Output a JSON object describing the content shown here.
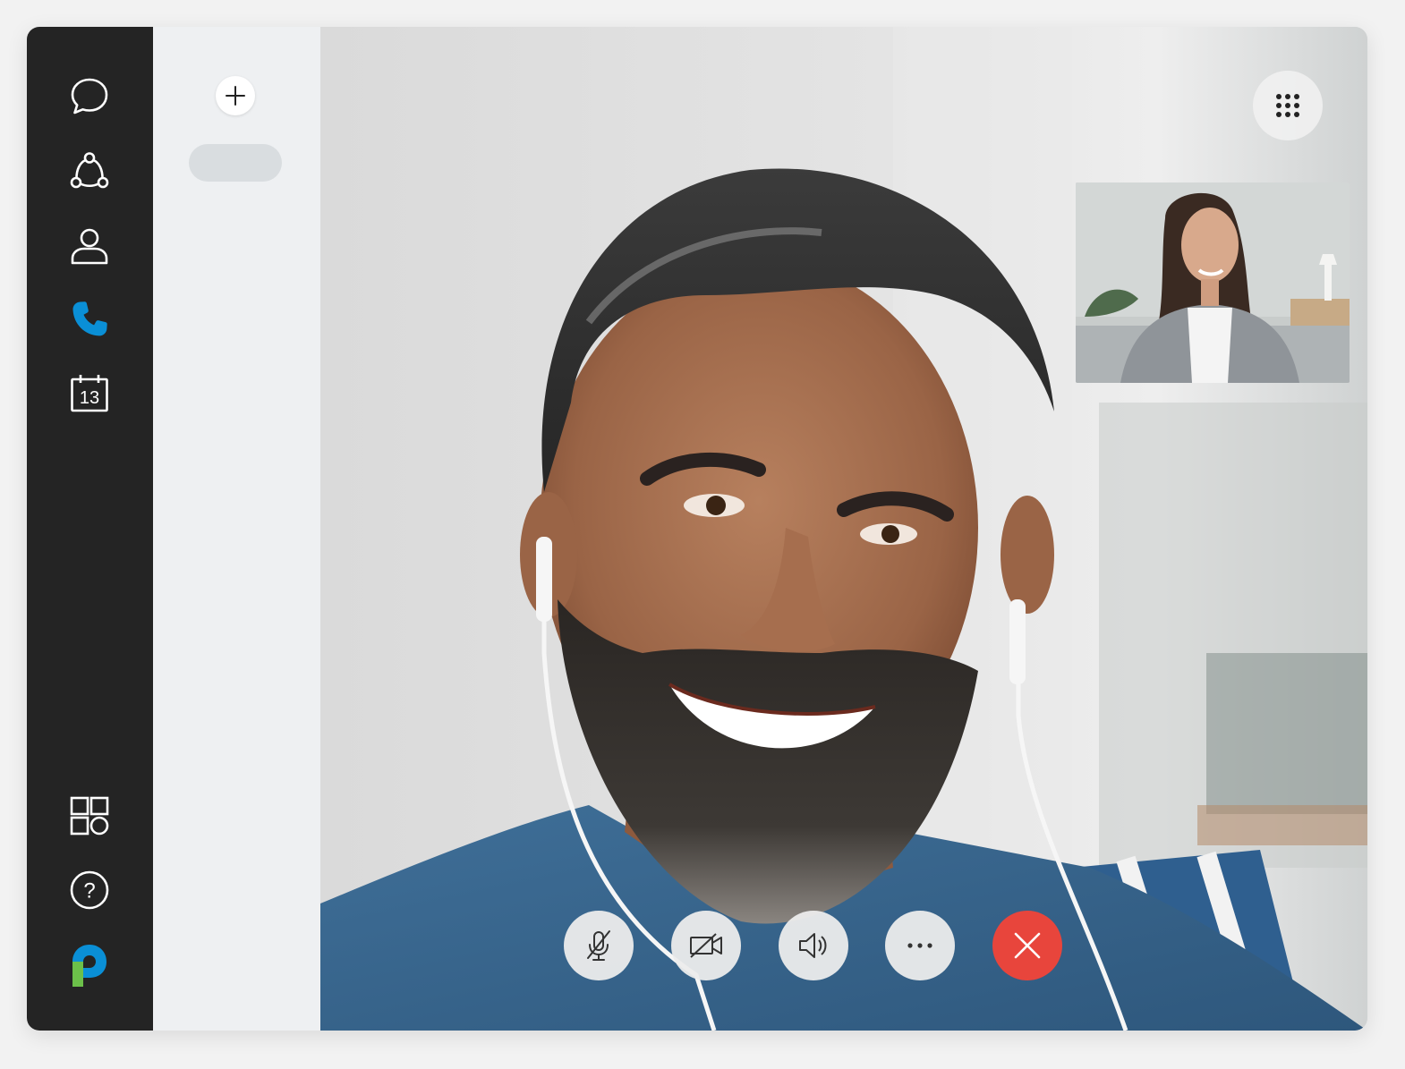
{
  "app": {
    "brand_color_blue": "#0a8fd6",
    "brand_color_green": "#6cc04a",
    "rail_background": "#242424"
  },
  "sidebar": {
    "items": [
      {
        "icon": "chat-bubble-icon",
        "active": false
      },
      {
        "icon": "team-icon",
        "active": false
      },
      {
        "icon": "contact-person-icon",
        "active": false
      },
      {
        "icon": "phone-icon",
        "active": true
      },
      {
        "icon": "calendar-icon",
        "active": false,
        "label": "13"
      }
    ],
    "bottom_items": [
      {
        "icon": "apps-grid-icon"
      },
      {
        "icon": "help-icon",
        "label": "?"
      },
      {
        "icon": "logo-icon"
      }
    ]
  },
  "call_controls": {
    "mute": {
      "icon": "mic-off-icon"
    },
    "video": {
      "icon": "video-off-icon"
    },
    "speaker": {
      "icon": "speaker-icon"
    },
    "more": {
      "icon": "more-icon"
    },
    "hangup": {
      "icon": "close-icon",
      "color": "#e8453c"
    }
  }
}
